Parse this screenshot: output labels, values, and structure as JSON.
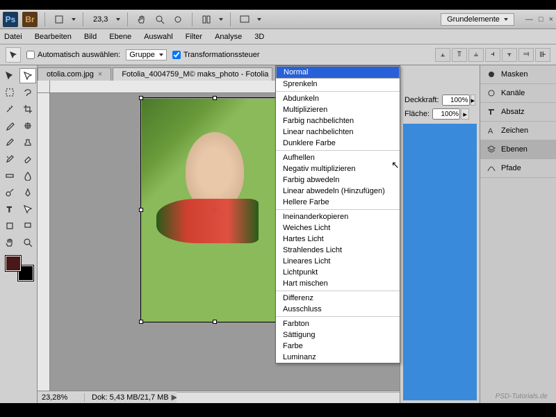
{
  "titlebar": {
    "zoom": "23,3",
    "workspace": "Grundelemente"
  },
  "menu": {
    "datei": "Datei",
    "bearbeiten": "Bearbeiten",
    "bild": "Bild",
    "ebene": "Ebene",
    "auswahl": "Auswahl",
    "filter": "Filter",
    "analyse": "Analyse",
    "dreid": "3D"
  },
  "opt": {
    "auto": "Automatisch auswählen:",
    "gruppe": "Gruppe",
    "trans": "Transformationssteuer"
  },
  "tabs": {
    "t1": "otolia.com.jpg",
    "t2": "Fotolia_4004759_M© maks_photo - Fotolia"
  },
  "blend": {
    "g1": [
      "Normal",
      "Sprenkeln"
    ],
    "g2": [
      "Abdunkeln",
      "Multiplizieren",
      "Farbig nachbelichten",
      "Linear nachbelichten",
      "Dunklere Farbe"
    ],
    "g3": [
      "Aufhellen",
      "Negativ multiplizieren",
      "Farbig abwedeln",
      "Linear abwedeln (Hinzufügen)",
      "Hellere Farbe"
    ],
    "g4": [
      "Ineinanderkopieren",
      "Weiches Licht",
      "Hartes Licht",
      "Strahlendes Licht",
      "Lineares Licht",
      "Lichtpunkt",
      "Hart mischen"
    ],
    "g5": [
      "Differenz",
      "Ausschluss"
    ],
    "g6": [
      "Farbton",
      "Sättigung",
      "Farbe",
      "Luminanz"
    ]
  },
  "layers": {
    "deckkraft_label": "Deckkraft:",
    "deckkraft_value": "100%",
    "flaeche_label": "Fläche:",
    "flaeche_value": "100%"
  },
  "dock": {
    "masken": "Masken",
    "kanaele": "Kanäle",
    "absatz": "Absatz",
    "zeichen": "Zeichen",
    "ebenen": "Ebenen",
    "pfade": "Pfade"
  },
  "status": {
    "zoom": "23,28%",
    "dok": "Dok: 5,43 MB/21,7 MB"
  },
  "watermark": "PSD-Tutorials.de"
}
